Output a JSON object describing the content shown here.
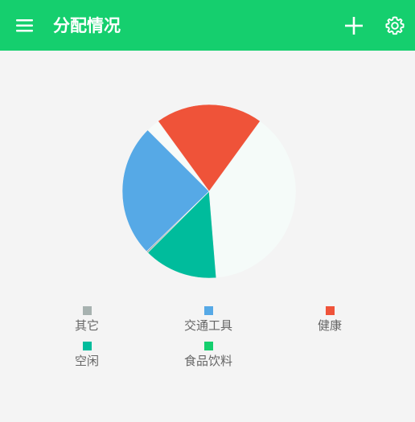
{
  "app": {
    "title": "分配情况"
  },
  "toolbar": {
    "menu_icon": "hamburger-menu-icon",
    "add_icon": "plus-icon",
    "settings_icon": "gear-icon"
  },
  "colors": {
    "appbar": "#15cf6e",
    "background": "#f4f4f4"
  },
  "chart_data": {
    "type": "pie",
    "title": "",
    "legend_position": "bottom",
    "slices": [
      {
        "label": "食品饮料",
        "value": 38.7,
        "color": "#f5fbf9"
      },
      {
        "label": "空闲",
        "value": 13.8,
        "color": "#00bc9c"
      },
      {
        "label": "其它",
        "value": 0.3,
        "color": "#9aa8a6"
      },
      {
        "label": "交通工具",
        "value": 24.7,
        "color": "#56a9e6"
      },
      {
        "label": "",
        "value": 2.5,
        "color": "#f7fbf9"
      },
      {
        "label": "健康",
        "value": 20.0,
        "color": "#ef5339"
      }
    ]
  },
  "legend": {
    "items": [
      {
        "label": "其它",
        "color": "#a7b2b0"
      },
      {
        "label": "交通工具",
        "color": "#56a9e6"
      },
      {
        "label": "健康",
        "color": "#ef5339"
      },
      {
        "label": "空闲",
        "color": "#00bc9c"
      },
      {
        "label": "食品饮料",
        "color": "#15cf6e"
      }
    ]
  }
}
